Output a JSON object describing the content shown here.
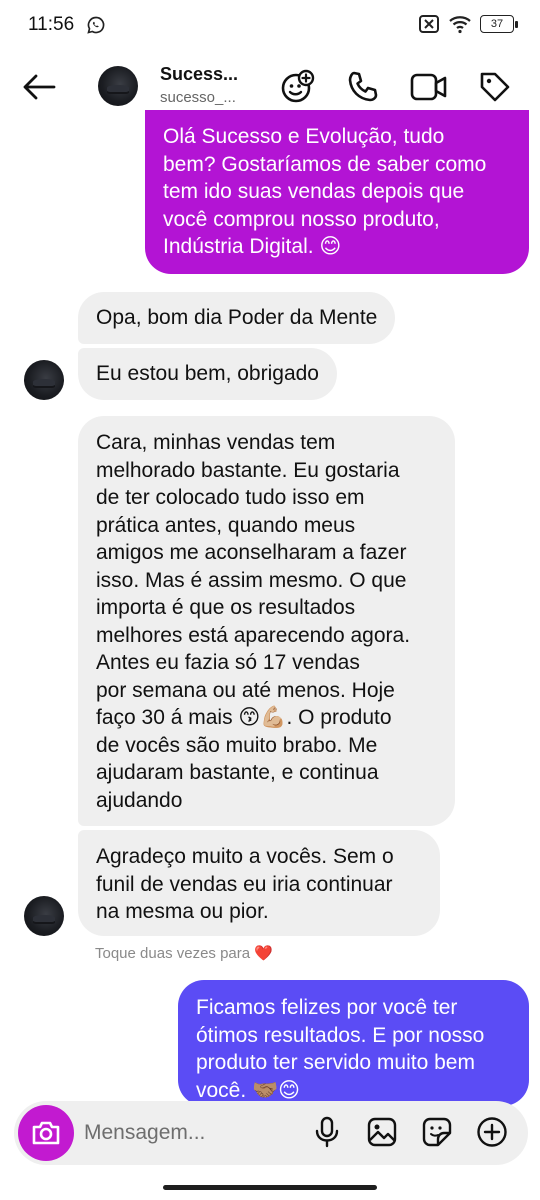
{
  "status_bar": {
    "time": "11:56",
    "battery": "37",
    "icons": [
      "whatsapp-icon",
      "sim-off-icon",
      "wifi-icon",
      "battery-icon"
    ]
  },
  "header": {
    "contact_name": "Sucess...",
    "contact_handle": "sucesso_...",
    "icons": [
      "back-arrow-icon",
      "effects-icon",
      "phone-icon",
      "video-icon",
      "tag-icon"
    ]
  },
  "messages": [
    {
      "direction": "outgoing",
      "lines": [
        "Olá Sucesso e Evolução, tudo",
        "bem? Gostaríamos de saber como",
        "tem ido suas vendas depois que",
        "você comprou nosso produto,",
        "Indústria Digital. 😊"
      ]
    },
    {
      "direction": "incoming",
      "lines": [
        "Opa, bom dia Poder da Mente"
      ]
    },
    {
      "direction": "incoming",
      "lines": [
        "Eu estou bem, obrigado"
      ]
    },
    {
      "direction": "incoming",
      "lines": [
        "Cara, minhas vendas tem",
        "melhorado bastante. Eu gostaria",
        "de ter colocado tudo isso em",
        "prática antes, quando meus",
        "amigos me aconselharam a fazer",
        "isso. Mas é assim mesmo. O que",
        "importa é que os resultados",
        "melhores está aparecendo agora.",
        "Antes eu fazia só 17 vendas",
        "por semana ou até menos. Hoje",
        "faço 30 á mais 😙💪🏼. O produto",
        "de vocês são muito brabo. Me",
        "ajudaram bastante, e continua",
        "ajudando"
      ]
    },
    {
      "direction": "incoming",
      "lines": [
        "Agradeço muito a vocês. Sem o",
        "funil de vendas eu iria continuar",
        "na mesma ou pior."
      ]
    },
    {
      "direction": "outgoing",
      "lines": [
        "Ficamos felizes por você ter",
        "ótimos resultados. E por nosso",
        "produto ter servido muito bem",
        "você. 🤝🏽😊"
      ]
    }
  ],
  "hint": {
    "text": "Toque duas vezes para",
    "heart": "❤️"
  },
  "composer": {
    "placeholder": "Mensagem...",
    "icons": [
      "camera-icon",
      "microphone-icon",
      "gallery-icon",
      "sticker-icon",
      "add-icon"
    ]
  },
  "colors": {
    "outgoing_purple": "#b314d4",
    "outgoing_blue": "#5b4cf5",
    "incoming_gray": "#efefef",
    "camera_button": "#c21ad0"
  }
}
